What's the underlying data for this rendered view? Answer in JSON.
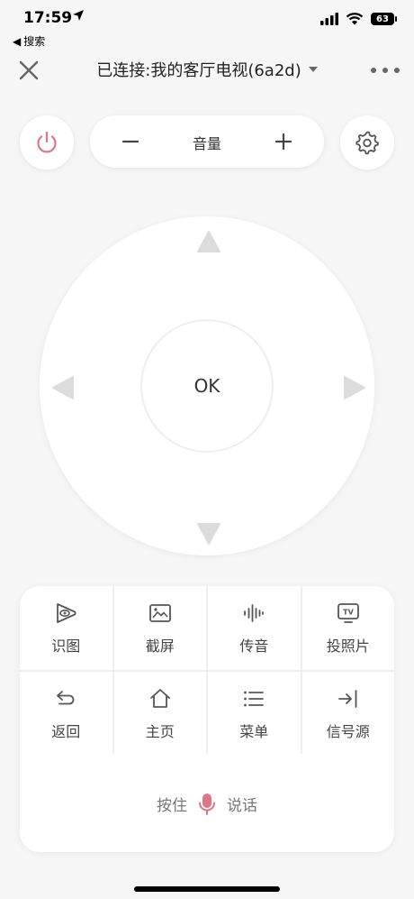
{
  "status_bar": {
    "time": "17:59",
    "back_label": "搜索",
    "battery": "63"
  },
  "header": {
    "title": "已连接:我的客厅电视(6a2d)"
  },
  "controls": {
    "volume_label": "音量",
    "ok_label": "OK"
  },
  "functions": {
    "row1": [
      {
        "label": "识图",
        "icon": "image-recognition-icon"
      },
      {
        "label": "截屏",
        "icon": "screenshot-icon"
      },
      {
        "label": "传音",
        "icon": "audio-wave-icon"
      },
      {
        "label": "投照片",
        "icon": "tv-cast-icon"
      }
    ],
    "row2": [
      {
        "label": "返回",
        "icon": "back-arrow-icon"
      },
      {
        "label": "主页",
        "icon": "home-icon"
      },
      {
        "label": "菜单",
        "icon": "menu-list-icon"
      },
      {
        "label": "信号源",
        "icon": "input-source-icon"
      }
    ]
  },
  "voice": {
    "hold_label": "按住",
    "talk_label": "说话"
  },
  "colors": {
    "accent": "#e07585",
    "background": "#f6f6f6",
    "icon_gray": "#555555",
    "arrow_gray": "#dcdcdc"
  }
}
